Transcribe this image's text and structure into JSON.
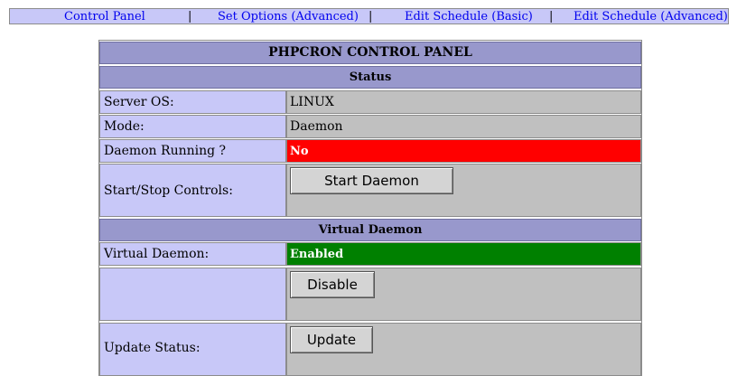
{
  "nav": {
    "links": [
      {
        "label": "Control Panel"
      },
      {
        "label": "Set Options (Advanced)"
      },
      {
        "label": "Edit Schedule (Basic)"
      },
      {
        "label": "Edit Schedule (Advanced)"
      }
    ],
    "separator": "|"
  },
  "panel": {
    "title": "PHPCRON CONTROL PANEL",
    "status_section": "Status",
    "server_os_label": "Server OS:",
    "server_os_value": "LINUX",
    "mode_label": "Mode:",
    "mode_value": "Daemon",
    "daemon_running_label": "Daemon Running ?",
    "daemon_running_value": "No",
    "controls_label": "Start/Stop Controls:",
    "start_button": "Start Daemon",
    "virtual_section": "Virtual Daemon",
    "virtual_label": "Virtual Daemon:",
    "virtual_value": "Enabled",
    "disable_button": "Disable",
    "update_status_label": "Update Status:",
    "update_button": "Update"
  },
  "colors": {
    "header": "#9898cc",
    "label_bg": "#c8c8f8",
    "value_bg": "#c0c0c0",
    "status_no": "#ff0000",
    "status_enabled": "#008000",
    "link": "#0000ee"
  }
}
